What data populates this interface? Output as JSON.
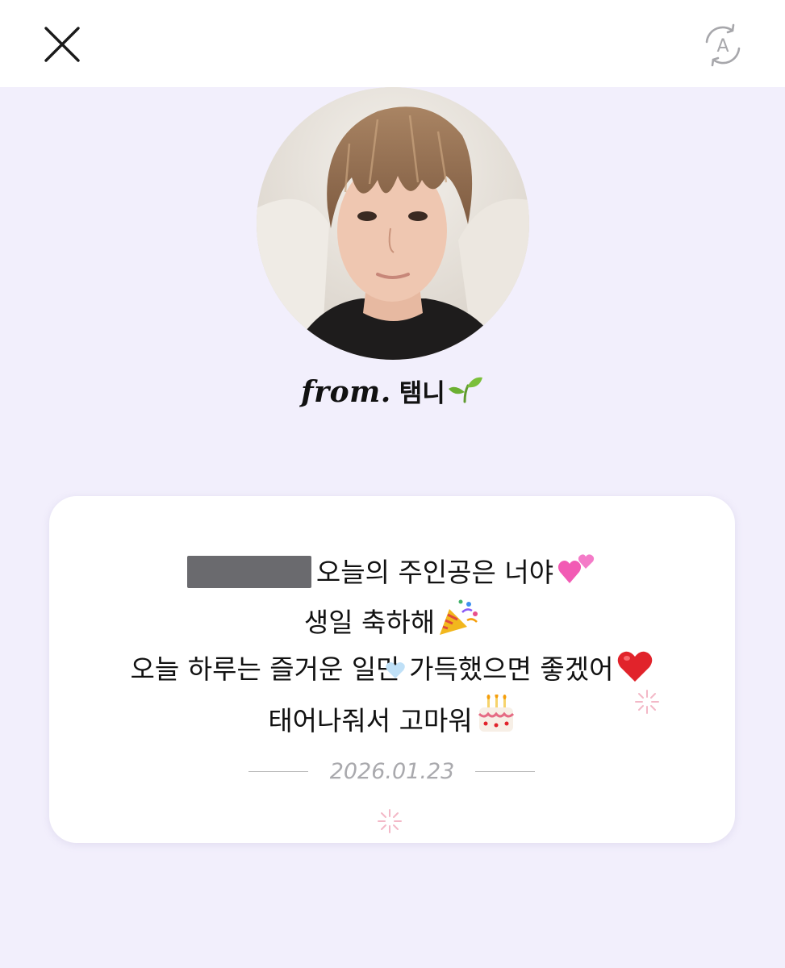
{
  "header": {
    "close_icon": "close-icon",
    "translate_icon": "auto-translate-icon",
    "translate_glyph": "A"
  },
  "profile": {
    "avatar": "profile-photo",
    "from_prefix": "from.",
    "sender_name": "탬니",
    "sender_emoji_icon": "sprout-icon"
  },
  "letter": {
    "lines": [
      "오늘의 주인공은 너야",
      "생일 축하해",
      "오늘 하루는 즐거운 일만 가득했으면 좋겠어",
      "태어나줘서 고마워"
    ],
    "line_emojis": [
      "two-hearts-icon",
      "party-popper-icon",
      "red-heart-icon",
      "birthday-cake-icon"
    ],
    "date": "2026.01.23"
  },
  "colors": {
    "page_background": "#f2effc",
    "card_background": "#ffffff",
    "date_text": "#a9a9ad",
    "redaction": "#6a6a6e"
  }
}
